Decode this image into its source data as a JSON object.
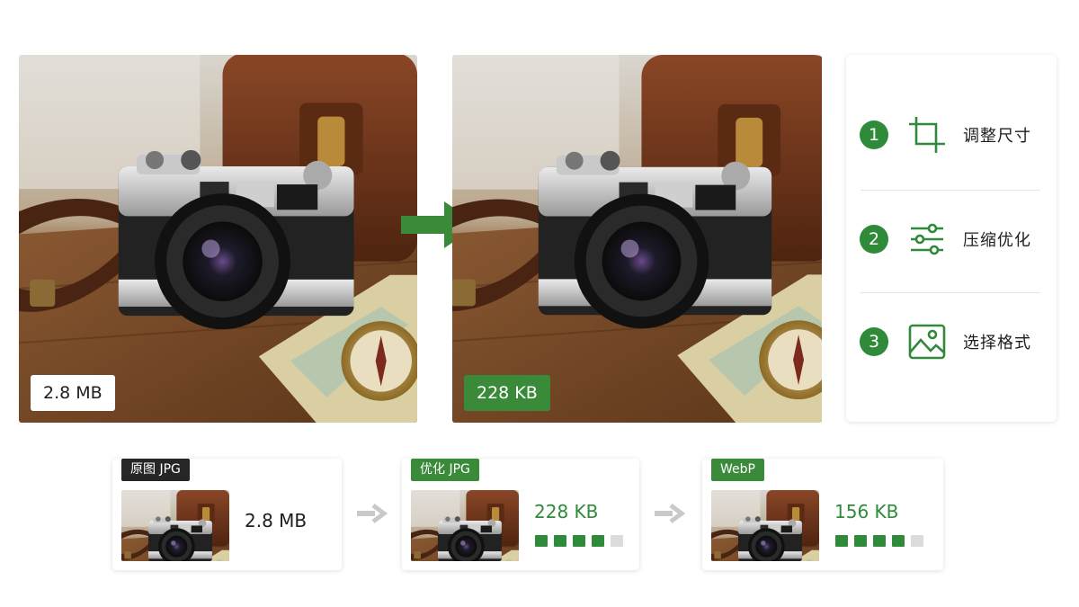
{
  "colors": {
    "accent_green": "#3a8a3a",
    "dark_tag": "#262626",
    "arrow_gray": "#c9c9c9"
  },
  "main": {
    "original_size": "2.8 MB",
    "optimized_size": "228 KB"
  },
  "steps": [
    {
      "number": "1",
      "icon": "crop-icon",
      "label": "调整尺寸"
    },
    {
      "number": "2",
      "icon": "sliders-icon",
      "label": "压缩优化"
    },
    {
      "number": "3",
      "icon": "image-icon",
      "label": "选择格式"
    }
  ],
  "cards": [
    {
      "tag": "原图 JPG",
      "size": "2.8 MB",
      "quality": null
    },
    {
      "tag": "优化 JPG",
      "size": "228 KB",
      "quality": 0.8
    },
    {
      "tag": "WebP",
      "size": "156 KB",
      "quality": 0.8
    }
  ]
}
